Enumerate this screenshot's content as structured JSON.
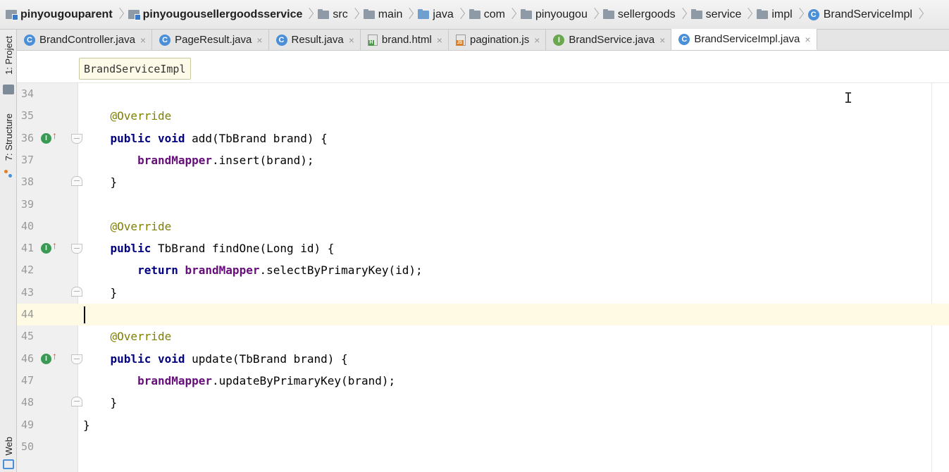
{
  "breadcrumbs": [
    {
      "label": "pinyougouparent",
      "icon": "module-icon",
      "bold": true
    },
    {
      "label": "pinyougousellergoodsservice",
      "icon": "module-icon",
      "bold": true
    },
    {
      "label": "src",
      "icon": "folder-icon",
      "bold": false
    },
    {
      "label": "main",
      "icon": "folder-icon",
      "bold": false
    },
    {
      "label": "java",
      "icon": "source-folder-icon",
      "bold": false
    },
    {
      "label": "com",
      "icon": "package-icon",
      "bold": false
    },
    {
      "label": "pinyougou",
      "icon": "package-icon",
      "bold": false
    },
    {
      "label": "sellergoods",
      "icon": "package-icon",
      "bold": false
    },
    {
      "label": "service",
      "icon": "package-icon",
      "bold": false
    },
    {
      "label": "impl",
      "icon": "package-icon",
      "bold": false
    },
    {
      "label": "BrandServiceImpl",
      "icon": "class-icon",
      "bold": false
    }
  ],
  "tabs": [
    {
      "label": "BrandController.java",
      "icon": "java-class-icon",
      "active": false
    },
    {
      "label": "PageResult.java",
      "icon": "java-class-icon",
      "active": false
    },
    {
      "label": "Result.java",
      "icon": "java-class-icon",
      "active": false
    },
    {
      "label": "brand.html",
      "icon": "html-file-icon",
      "active": false
    },
    {
      "label": "pagination.js",
      "icon": "js-file-icon",
      "active": false
    },
    {
      "label": "BrandService.java",
      "icon": "java-interface-icon",
      "active": false
    },
    {
      "label": "BrandServiceImpl.java",
      "icon": "java-class-icon",
      "active": true
    }
  ],
  "tab_close_glyph": "×",
  "side_tools": {
    "project": "1: Project",
    "structure": "7: Structure",
    "web": "Web"
  },
  "editor": {
    "class_breadcrumb": "BrandServiceImpl",
    "current_line": 44,
    "lines": [
      {
        "no": "34",
        "tokens": []
      },
      {
        "no": "35",
        "tokens": [
          {
            "t": "    "
          },
          {
            "t": "@Override",
            "c": "ann"
          }
        ]
      },
      {
        "no": "36",
        "marker": "implements",
        "fold": "open",
        "tokens": [
          {
            "t": "    "
          },
          {
            "t": "public",
            "c": "kw"
          },
          {
            "t": " "
          },
          {
            "t": "void",
            "c": "kw"
          },
          {
            "t": " add(TbBrand brand) {"
          }
        ]
      },
      {
        "no": "37",
        "tokens": [
          {
            "t": "        "
          },
          {
            "t": "brandMapper",
            "c": "fld"
          },
          {
            "t": ".insert(brand);"
          }
        ]
      },
      {
        "no": "38",
        "fold": "close",
        "tokens": [
          {
            "t": "    }"
          }
        ]
      },
      {
        "no": "39",
        "tokens": []
      },
      {
        "no": "40",
        "tokens": [
          {
            "t": "    "
          },
          {
            "t": "@Override",
            "c": "ann"
          }
        ]
      },
      {
        "no": "41",
        "marker": "implements",
        "fold": "open",
        "tokens": [
          {
            "t": "    "
          },
          {
            "t": "public",
            "c": "kw"
          },
          {
            "t": " TbBrand findOne(Long id) {"
          }
        ]
      },
      {
        "no": "42",
        "tokens": [
          {
            "t": "        "
          },
          {
            "t": "return",
            "c": "kw"
          },
          {
            "t": " "
          },
          {
            "t": "brandMapper",
            "c": "fld"
          },
          {
            "t": ".selectByPrimaryKey(id);"
          }
        ]
      },
      {
        "no": "43",
        "fold": "close",
        "tokens": [
          {
            "t": "    }"
          }
        ]
      },
      {
        "no": "44",
        "caret": true,
        "tokens": []
      },
      {
        "no": "45",
        "tokens": [
          {
            "t": "    "
          },
          {
            "t": "@Override",
            "c": "ann"
          }
        ]
      },
      {
        "no": "46",
        "marker": "implements",
        "fold": "open",
        "tokens": [
          {
            "t": "    "
          },
          {
            "t": "public",
            "c": "kw"
          },
          {
            "t": " "
          },
          {
            "t": "void",
            "c": "kw"
          },
          {
            "t": " update(TbBrand brand) {"
          }
        ]
      },
      {
        "no": "47",
        "tokens": [
          {
            "t": "        "
          },
          {
            "t": "brandMapper",
            "c": "fld"
          },
          {
            "t": ".updateByPrimaryKey(brand);"
          }
        ]
      },
      {
        "no": "48",
        "fold": "close",
        "tokens": [
          {
            "t": "    }"
          }
        ]
      },
      {
        "no": "49",
        "tokens": [
          {
            "t": "}"
          }
        ]
      },
      {
        "no": "50",
        "tokens": []
      }
    ]
  },
  "marker_letter": "I",
  "colors": {
    "keyword": "#000080",
    "annotation": "#808000",
    "field": "#660e7a",
    "current_line": "#fffae3",
    "line_number": "#999999"
  }
}
